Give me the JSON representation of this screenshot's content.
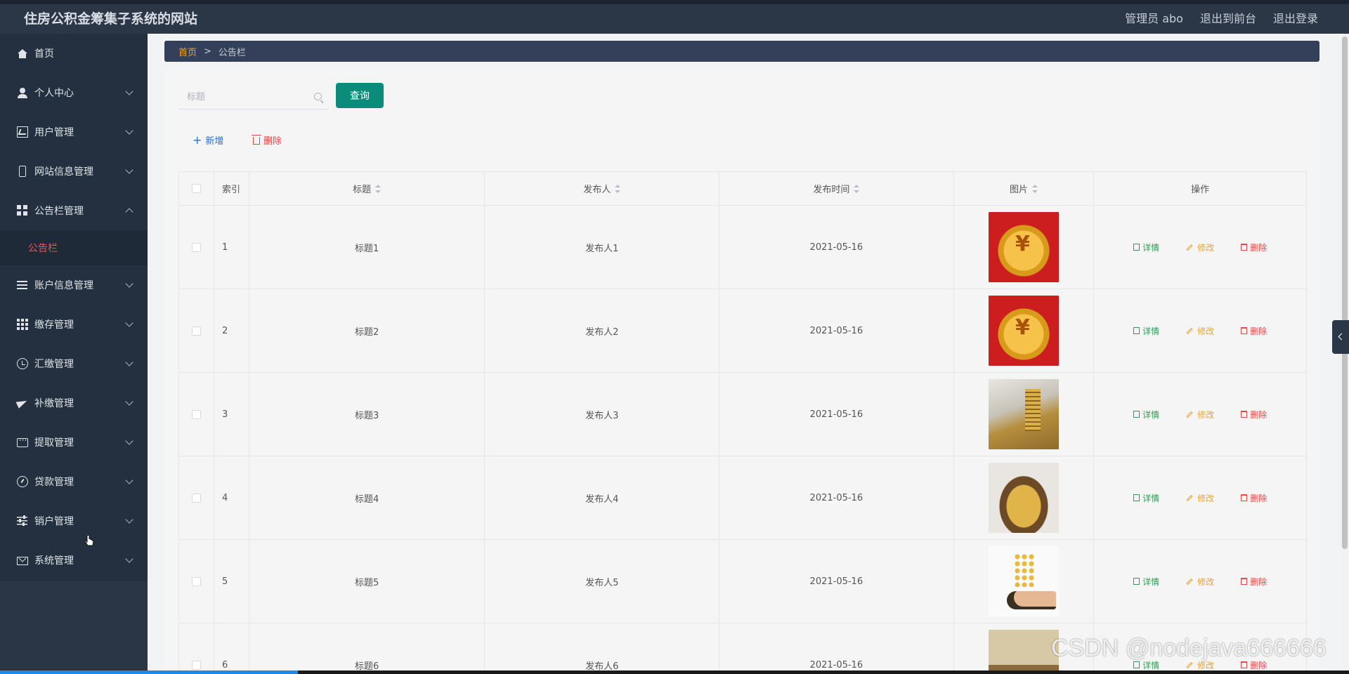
{
  "header": {
    "site_title": "住房公积金筹集子系统的网站",
    "admin_label": "管理员 abo",
    "to_front": "退出到前台",
    "logout": "退出登录"
  },
  "sidebar": {
    "items": [
      {
        "label": "首页",
        "icon": "home-icon"
      },
      {
        "label": "个人中心",
        "icon": "user-icon"
      },
      {
        "label": "用户管理",
        "icon": "chart-icon"
      },
      {
        "label": "网站信息管理",
        "icon": "phone-icon"
      },
      {
        "label": "公告栏管理",
        "icon": "grid-icon",
        "expanded": true,
        "children": [
          {
            "label": "公告栏"
          }
        ]
      },
      {
        "label": "账户信息管理",
        "icon": "list-icon"
      },
      {
        "label": "缴存管理",
        "icon": "apps-icon"
      },
      {
        "label": "汇缴管理",
        "icon": "clock-icon"
      },
      {
        "label": "补缴管理",
        "icon": "send-icon"
      },
      {
        "label": "提取管理",
        "icon": "chat-icon"
      },
      {
        "label": "贷款管理",
        "icon": "gauge-icon"
      },
      {
        "label": "销户管理",
        "icon": "sliders-icon"
      },
      {
        "label": "系统管理",
        "icon": "mail-icon"
      }
    ]
  },
  "breadcrumb": {
    "home": "首页",
    "separator": ">",
    "current": "公告栏"
  },
  "search": {
    "placeholder": "标题",
    "value": "",
    "button": "查询"
  },
  "actions": {
    "add": "新增",
    "delete": "删除"
  },
  "table": {
    "columns": [
      "索引",
      "标题",
      "发布人",
      "发布时间",
      "图片",
      "操作"
    ],
    "rows": [
      {
        "index": "1",
        "title": "标题1",
        "publisher": "发布人1",
        "time": "2021-05-16"
      },
      {
        "index": "2",
        "title": "标题2",
        "publisher": "发布人2",
        "time": "2021-05-16"
      },
      {
        "index": "3",
        "title": "标题3",
        "publisher": "发布人3",
        "time": "2021-05-16"
      },
      {
        "index": "4",
        "title": "标题4",
        "publisher": "发布人4",
        "time": "2021-05-16"
      },
      {
        "index": "5",
        "title": "标题5",
        "publisher": "发布人5",
        "time": "2021-05-16"
      },
      {
        "index": "6",
        "title": "标题6",
        "publisher": "发布人6",
        "time": "2021-05-16"
      }
    ],
    "ops": {
      "detail": "详情",
      "edit": "修改",
      "delete": "删除"
    }
  },
  "watermark": "CSDN @nodejava666666",
  "colors": {
    "sidebar_bg": "#24303f",
    "topbar_bg": "#2b3646",
    "accent_green": "#0b8c7b",
    "active_red": "#ef5350",
    "breadcrumb_home": "#f0a430"
  }
}
